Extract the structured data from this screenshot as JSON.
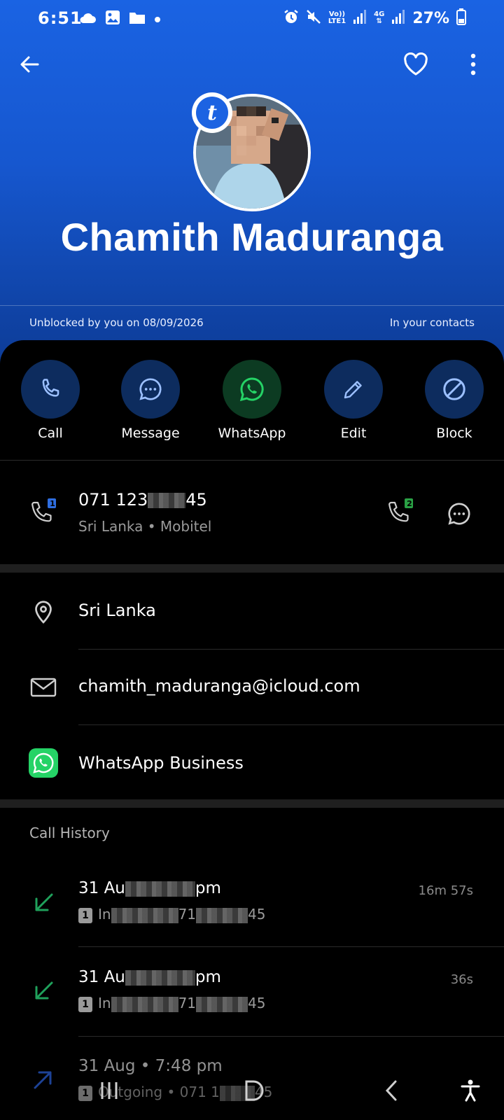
{
  "status_bar": {
    "time": "6:51",
    "battery": "27%",
    "volte": "Vo))",
    "lte": "LTE1",
    "network": "4G",
    "icons": [
      "cloud-icon",
      "image-icon",
      "folder-icon",
      "dot-icon",
      "alarm-icon",
      "mute-icon",
      "signal-icon",
      "battery-icon"
    ]
  },
  "top_bar": {
    "back_icon": "arrow-left-icon",
    "favorite_icon": "heart-icon",
    "more_icon": "more-vertical-icon"
  },
  "contact": {
    "name": "Chamith Maduranga",
    "badge_letter": "t",
    "unblocked_text": "Unblocked by you on 08/09/2026",
    "contacts_status": "In your contacts"
  },
  "actions": [
    {
      "label": "Call",
      "icon": "phone-icon"
    },
    {
      "label": "Message",
      "icon": "message-icon"
    },
    {
      "label": "WhatsApp",
      "icon": "whatsapp-icon"
    },
    {
      "label": "Edit",
      "icon": "pencil-icon"
    },
    {
      "label": "Block",
      "icon": "block-icon"
    }
  ],
  "phone": {
    "number_start": "071 123",
    "number_end": "45",
    "details": "Sri Lanka • Mobitel",
    "sim1_badge": "1",
    "sim2_badge": "2"
  },
  "info": {
    "location": "Sri Lanka",
    "email": "chamith_maduranga@icloud.com",
    "whatsapp_business": "WhatsApp Business"
  },
  "call_history": {
    "title": "Call History",
    "items": [
      {
        "date_start": "31 Au",
        "date_end": "pm",
        "type_start": "In",
        "number_mid": "71",
        "number_end": "45",
        "duration": "16m 57s",
        "sim": "1",
        "direction": "incoming"
      },
      {
        "date_start": "31 Au",
        "date_end": "pm",
        "type_start": "In",
        "number_mid": "71",
        "number_end": "45",
        "duration": "36s",
        "sim": "1",
        "direction": "incoming"
      },
      {
        "date_start": "31 Aug • 7:48 pm",
        "type_start": "Outgoing • 071 1",
        "number_end": "45",
        "duration": "",
        "sim": "1",
        "direction": "outgoing"
      }
    ]
  },
  "nav_bar": {
    "recents_icon": "recents-icon",
    "home_icon": "home-icon",
    "back_icon": "back-chevron-icon",
    "accessibility_icon": "accessibility-icon"
  },
  "colors": {
    "header_blue": "#1a63e3",
    "action_bg": "#0d2c5e",
    "whatsapp_bg": "#0c3b22",
    "whatsapp_green": "#25d366",
    "incoming_green": "#1fa15b",
    "outgoing_blue": "#2a5fd6"
  }
}
